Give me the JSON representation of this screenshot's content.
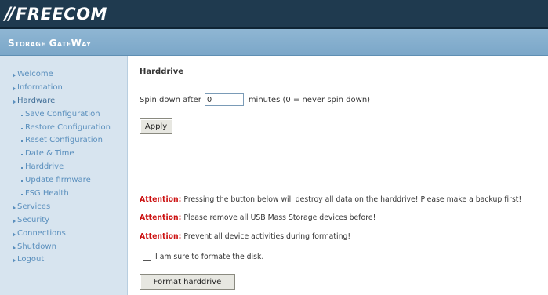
{
  "brand": {
    "logo_slashes": "//",
    "logo_text": "FREECOM",
    "product": "Storage GateWay"
  },
  "sidebar": {
    "items": [
      {
        "label": "Welcome",
        "level": "top"
      },
      {
        "label": "Information",
        "level": "top"
      },
      {
        "label": "Hardware",
        "level": "top",
        "expanded": true
      },
      {
        "label": "Save Configuration",
        "level": "sub"
      },
      {
        "label": "Restore Configuration",
        "level": "sub"
      },
      {
        "label": "Reset Configuration",
        "level": "sub"
      },
      {
        "label": "Date & Time",
        "level": "sub"
      },
      {
        "label": "Harddrive",
        "level": "sub",
        "active": true
      },
      {
        "label": "Update firmware",
        "level": "sub"
      },
      {
        "label": "FSG Health",
        "level": "sub"
      },
      {
        "label": "Services",
        "level": "top"
      },
      {
        "label": "Security",
        "level": "top"
      },
      {
        "label": "Connections",
        "level": "top"
      },
      {
        "label": "Shutdown",
        "level": "top"
      },
      {
        "label": "Logout",
        "level": "top"
      }
    ]
  },
  "main": {
    "title": "Harddrive",
    "spin": {
      "prefix": "Spin down after",
      "value": "0",
      "suffix": "minutes (0 = never spin down)"
    },
    "apply_label": "Apply",
    "attention_label": "Attention:",
    "warnings": [
      "Pressing the button below will destroy all data on the harddrive! Please make a backup first!",
      "Please remove all USB Mass Storage devices before!",
      "Prevent all device activities during formating!"
    ],
    "confirm_label": "I am sure to formate the disk.",
    "confirm_checked": false,
    "format_label": "Format harddrive"
  },
  "colors": {
    "header_bg": "#1f3a4f",
    "band_bg": "#7aa6c8",
    "sidebar_bg": "#d7e4ef",
    "link": "#5a8fbd",
    "attention": "#cc1111"
  },
  "icons": {
    "nav_top": "triangle-right-icon",
    "nav_sub": "bullet-icon"
  }
}
